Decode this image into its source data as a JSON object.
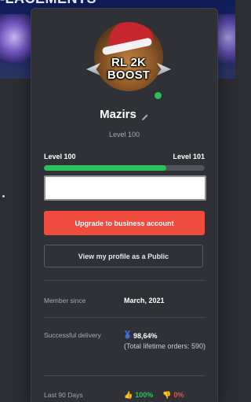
{
  "background": {
    "header_title": "-LACEMENTS"
  },
  "profile": {
    "avatar_text_line1": "RL 2K",
    "avatar_text_line2": "BOOST",
    "name": "Mazirs",
    "level_label": "Level 100",
    "xp": {
      "current_label": "Level 100",
      "next_label": "Level 101",
      "progress_percent": 76
    }
  },
  "actions": {
    "upgrade_label": "Upgrade to business account",
    "view_public_label": "View my profile as a Public"
  },
  "stats": {
    "member_since_label": "Member since",
    "member_since_value": "March, 2021",
    "delivery_label": "Successful delivery",
    "delivery_percent": "98,64%",
    "delivery_note": "(Total lifetime orders: 590)",
    "last90_label": "Last 90 Days",
    "positive": "100%",
    "negative": "0%"
  },
  "colors": {
    "accent_red": "#f04b3f",
    "progress_green": "#28c35a",
    "panel_bg": "#2f3136"
  },
  "icons": {
    "edit": "pencil-icon",
    "delivery": "medal-icon",
    "positive": "thumbs-up-icon",
    "negative": "thumbs-down-icon"
  }
}
